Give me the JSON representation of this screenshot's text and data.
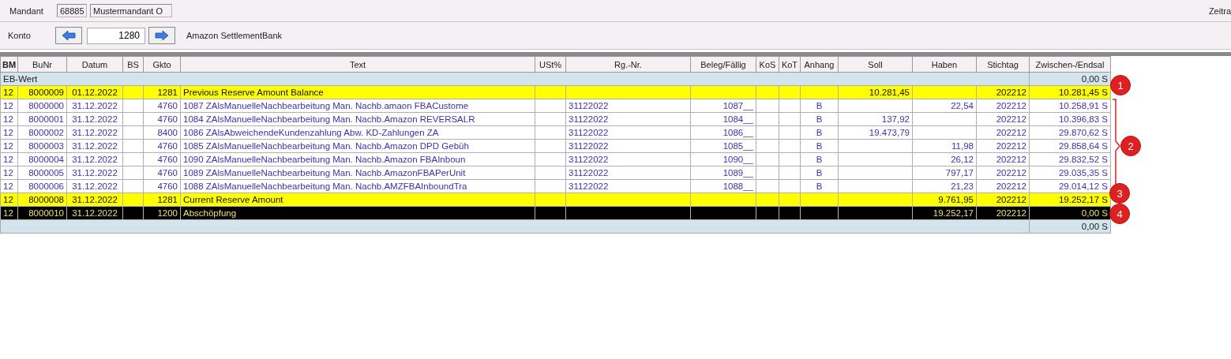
{
  "header": {
    "mandant_label": "Mandant",
    "mandant_number": "68885",
    "mandant_name": "Mustermandant O",
    "period_label": "Zeitra",
    "konto_label": "Konto",
    "konto_number": "1280",
    "konto_name": "Amazon SettlementBank"
  },
  "table": {
    "columns": [
      "BM",
      "BuNr",
      "Datum",
      "BS",
      "Gkto",
      "Text",
      "USt%",
      "Rg.-Nr.",
      "Beleg/Fällig",
      "KoS",
      "KoT",
      "Anhang",
      "Soll",
      "Haben",
      "Stichtag",
      "Zwischen-/Endsal"
    ],
    "opening": {
      "label": "EB-Wert",
      "balance": "0,00 S"
    },
    "rows": [
      {
        "kind": "highlight",
        "bm": "12",
        "bunr": "8000009",
        "datum": "01.12.2022",
        "gkto": "1281",
        "text": "Previous Reserve Amount Balance",
        "soll": "10.281,45",
        "stichtag": "202212",
        "saldo": "10.281,45 S"
      },
      {
        "kind": "normal",
        "bm": "12",
        "bunr": "8000000",
        "datum": "31.12.2022",
        "gkto": "4760",
        "text": "1087 ZAlsManuelleNachbearbeitung Man. Nachb.amaon FBACustome",
        "rg": "31122022",
        "beleg": "1087__",
        "anhang": "B",
        "haben": "22,54",
        "stichtag": "202212",
        "saldo": "10.258,91 S"
      },
      {
        "kind": "normal",
        "bm": "12",
        "bunr": "8000001",
        "datum": "31.12.2022",
        "gkto": "4760",
        "text": "1084 ZAlsManuelleNachbearbeitung Man. Nachb.Amazon REVERSALR",
        "rg": "31122022",
        "beleg": "1084__",
        "anhang": "B",
        "soll": "137,92",
        "stichtag": "202212",
        "saldo": "10.396,83 S"
      },
      {
        "kind": "normal",
        "bm": "12",
        "bunr": "8000002",
        "datum": "31.12.2022",
        "gkto": "8400",
        "text": "1086 ZAlsAbweichendeKundenzahlung Abw. KD-Zahlungen ZA",
        "rg": "31122022",
        "beleg": "1086__",
        "anhang": "B",
        "soll": "19.473,79",
        "stichtag": "202212",
        "saldo": "29.870,62 S"
      },
      {
        "kind": "normal",
        "bm": "12",
        "bunr": "8000003",
        "datum": "31.12.2022",
        "gkto": "4760",
        "text": "1085 ZAlsManuelleNachbearbeitung Man. Nachb.Amazon DPD Gebüh",
        "rg": "31122022",
        "beleg": "1085__",
        "anhang": "B",
        "haben": "11,98",
        "stichtag": "202212",
        "saldo": "29.858,64 S"
      },
      {
        "kind": "normal",
        "bm": "12",
        "bunr": "8000004",
        "datum": "31.12.2022",
        "gkto": "4760",
        "text": "1090 ZAlsManuelleNachbearbeitung Man. Nachb.Amazon FBAInboun",
        "rg": "31122022",
        "beleg": "1090__",
        "anhang": "B",
        "haben": "26,12",
        "stichtag": "202212",
        "saldo": "29.832,52 S"
      },
      {
        "kind": "normal",
        "bm": "12",
        "bunr": "8000005",
        "datum": "31.12.2022",
        "gkto": "4760",
        "text": "1089 ZAlsManuelleNachbearbeitung Man. Nachb.AmazonFBAPerUnit",
        "rg": "31122022",
        "beleg": "1089__",
        "anhang": "B",
        "haben": "797,17",
        "stichtag": "202212",
        "saldo": "29.035,35 S"
      },
      {
        "kind": "normal",
        "bm": "12",
        "bunr": "8000006",
        "datum": "31.12.2022",
        "gkto": "4760",
        "text": "1088 ZAlsManuelleNachbearbeitung Man. Nachb.AMZFBAInboundTra",
        "rg": "31122022",
        "beleg": "1088__",
        "anhang": "B",
        "haben": "21,23",
        "stichtag": "202212",
        "saldo": "29.014,12 S"
      },
      {
        "kind": "highlight",
        "bm": "12",
        "bunr": "8000008",
        "datum": "31.12.2022",
        "gkto": "1281",
        "text": "Current Reserve Amount",
        "haben": "9.761,95",
        "stichtag": "202212",
        "saldo": "19.252,17 S"
      },
      {
        "kind": "dark",
        "bm": "12",
        "bunr": "8000010",
        "datum": "31.12.2022",
        "gkto": "1200",
        "text": "Abschöpfung",
        "haben": "19.252,17",
        "stichtag": "202212",
        "saldo": "0,00 S"
      }
    ],
    "closing": {
      "balance": "0,00 S"
    }
  },
  "annotations": [
    "1",
    "2",
    "3",
    "4"
  ]
}
